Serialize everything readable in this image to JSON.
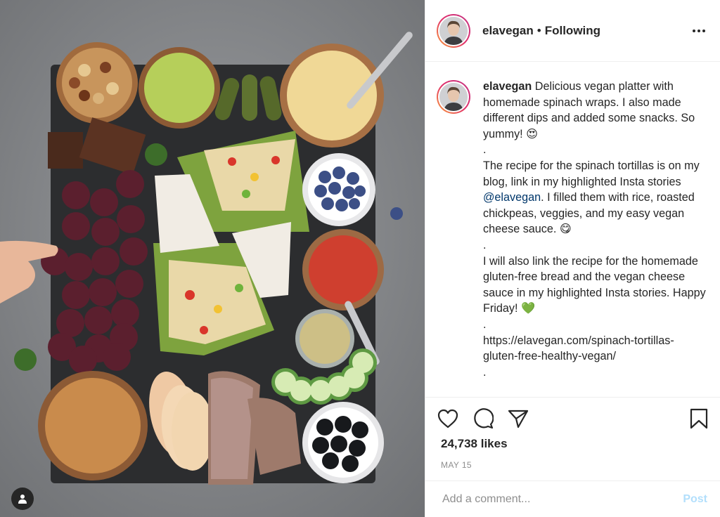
{
  "post": {
    "image_alt": "Vegan platter with spinach wraps, dips, snacks, grapes, blueberries, olives, chickpeas, bread and apple slices on a slate board"
  },
  "header": {
    "username": "elavegan",
    "separator": "•",
    "follow_status": "Following",
    "more_icon": "more-horizontal-icon"
  },
  "caption": {
    "username": "elavegan",
    "line1": " Delicious vegan platter with homemade spinach wraps. I also made different dips and added some snacks. So yummy! 😍",
    "dot1": ".",
    "line2a": "The recipe for the spinach tortillas is on my blog, link in my highlighted Insta stories ",
    "mention": "@elavegan",
    "line2b": ". I filled them with rice, roasted chickpeas, veggies, and my easy vegan cheese sauce. 😋",
    "dot2": ".",
    "line3": "I will also link the recipe for the homemade gluten-free bread and the vegan cheese sauce in my highlighted Insta stories. Happy Friday! 💚",
    "dot3": ".",
    "link": "https://elavegan.com/spinach-tortillas-gluten-free-healthy-vegan/",
    "dot4": "."
  },
  "actions": {
    "like_icon": "heart-icon",
    "comment_icon": "comment-icon",
    "share_icon": "share-icon",
    "save_icon": "bookmark-icon"
  },
  "likes": "24,738 likes",
  "date": "MAY 15",
  "comment_box": {
    "placeholder": "Add a comment...",
    "post_label": "Post"
  },
  "colors": {
    "text": "#262626",
    "muted": "#8e8e8e",
    "link": "#00376b",
    "post_disabled": "#b2dffc",
    "border": "#efefef"
  }
}
